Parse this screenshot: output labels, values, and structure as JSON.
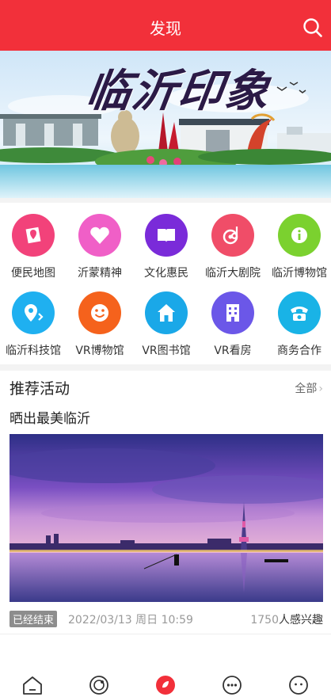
{
  "header": {
    "title": "发现",
    "search_icon": "search-icon",
    "accent": "#f2303a"
  },
  "banner": {
    "title": "临沂印象"
  },
  "grid": {
    "items": [
      {
        "label": "便民地图",
        "icon": "map-icon",
        "color": "#f2427a"
      },
      {
        "label": "沂蒙精神",
        "icon": "heart-icon",
        "color": "#f05fc7"
      },
      {
        "label": "文化惠民",
        "icon": "book-icon",
        "color": "#7a2bd9"
      },
      {
        "label": "临沂大剧院",
        "icon": "music-icon",
        "color": "#f04d68"
      },
      {
        "label": "临沂博物馆",
        "icon": "info-icon",
        "color": "#7bd12f"
      },
      {
        "label": "临沂科技馆",
        "icon": "location-icon",
        "color": "#1fb0f0"
      },
      {
        "label": "VR博物馆",
        "icon": "smile-icon",
        "color": "#f5621c"
      },
      {
        "label": "VR图书馆",
        "icon": "home-icon",
        "color": "#1aa8e8"
      },
      {
        "label": "VR看房",
        "icon": "building-icon",
        "color": "#6b57e8"
      },
      {
        "label": "商务合作",
        "icon": "phone-icon",
        "color": "#19b3e6"
      }
    ]
  },
  "recommend": {
    "title": "推荐活动",
    "all_label": "全部",
    "activity": {
      "title": "晒出最美临沂",
      "status": "已经结束",
      "datetime": "2022/03/13 周日 10:59",
      "count": "1750",
      "interest_label": "人感兴趣"
    }
  },
  "bottom_nav": [
    "home-icon",
    "discover-icon",
    "center-icon",
    "message-icon",
    "profile-icon"
  ]
}
